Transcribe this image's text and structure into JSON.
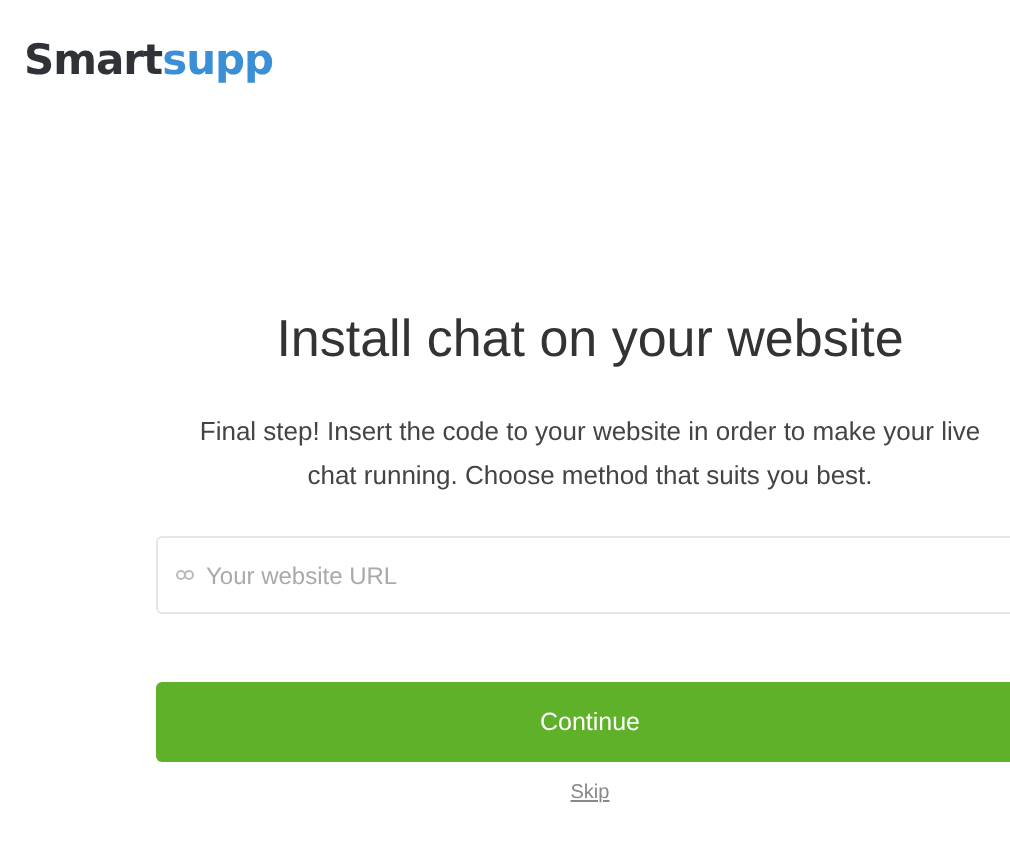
{
  "logo": {
    "main": "Smart",
    "accent": "supp"
  },
  "heading": "Install chat on your website",
  "description": "Final step! Insert the code to your website in order to make your live chat running. Choose method that suits you best.",
  "url_field": {
    "placeholder": "Your website URL"
  },
  "continue_button": "Continue",
  "skip_link": "Skip"
}
